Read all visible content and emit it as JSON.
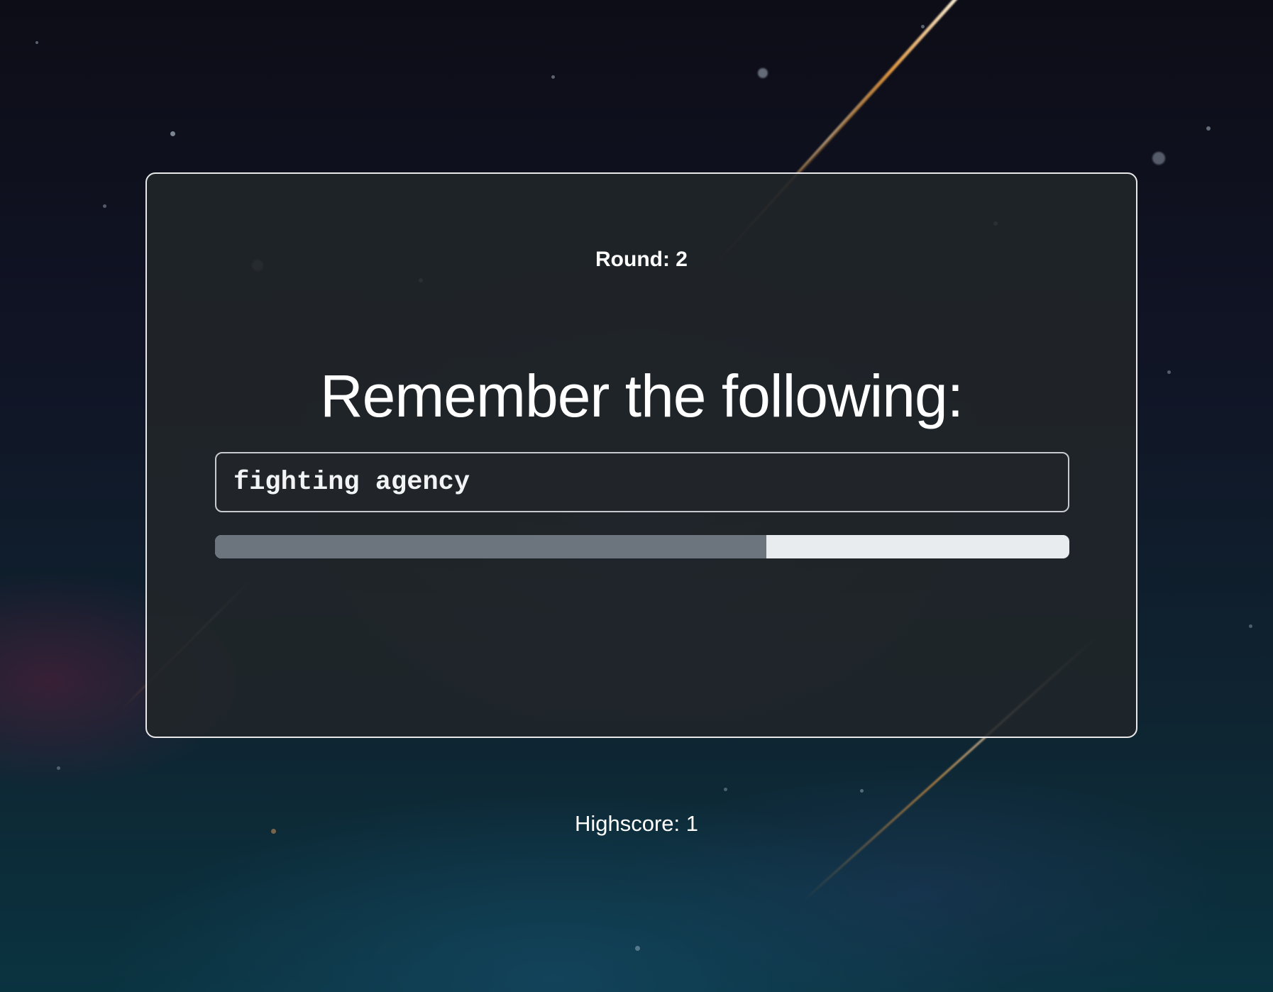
{
  "game": {
    "round_label": "Round: 2",
    "prompt_heading": "Remember the following:",
    "word": "fighting agency",
    "timer_progress": 0.645,
    "highscore_label": "Highscore: 1"
  },
  "colors": {
    "card_background": "#212529",
    "card_border": "#e8e8ea",
    "progress_fill": "#6c757d",
    "progress_track": "#e9ecef",
    "text": "#ffffff"
  }
}
